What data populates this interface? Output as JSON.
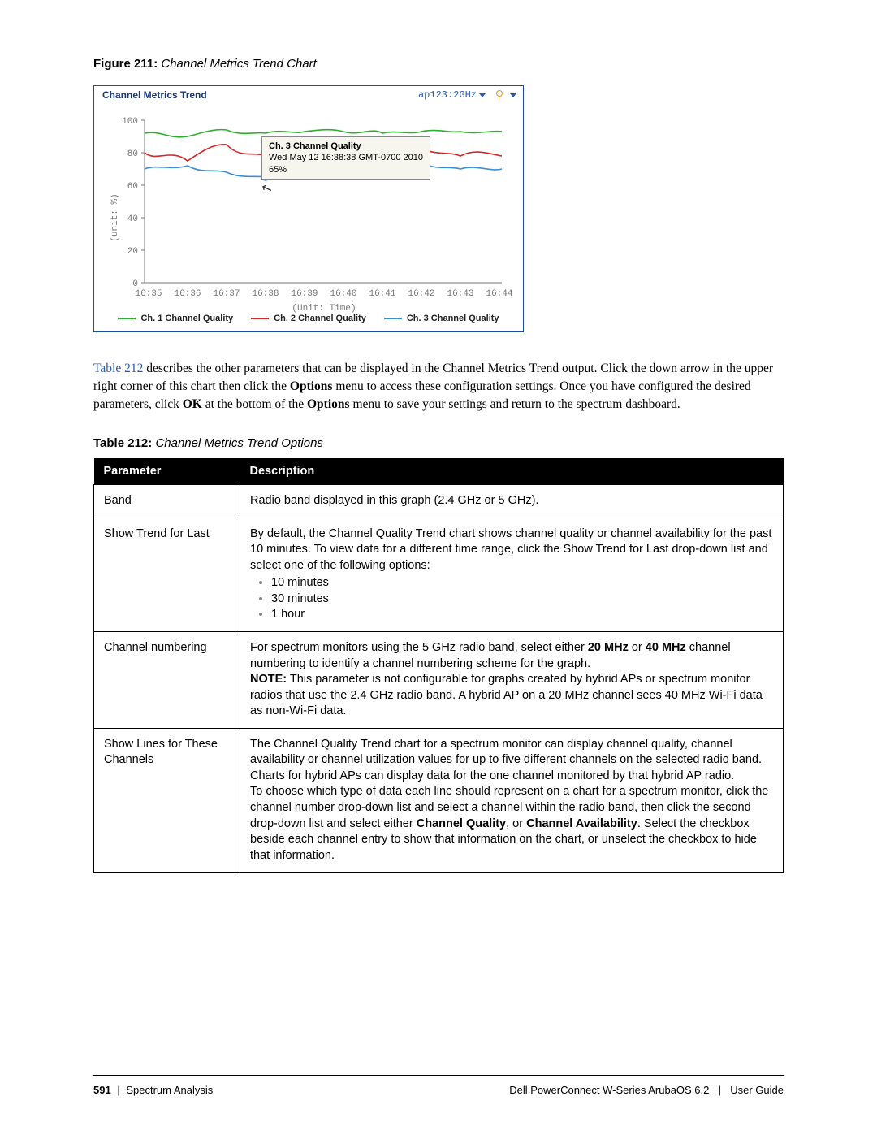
{
  "figure": {
    "label": "Figure 211:",
    "title": "Channel Metrics Trend Chart"
  },
  "chart": {
    "panel_title": "Channel Metrics Trend",
    "band_label": "ap123:2GHz",
    "tooltip_title": "Ch. 3 Channel Quality",
    "tooltip_time": "Wed May 12 16:38:38 GMT-0700 2010",
    "tooltip_val": "65%",
    "ylabel": "(unit: %)",
    "xlabel": "(Unit: Time)",
    "legend": {
      "s1": "Ch. 1 Channel Quality",
      "s2": "Ch. 2 Channel Quality",
      "s3": "Ch. 3 Channel Quality"
    }
  },
  "chart_data": {
    "type": "line",
    "title": "Channel Metrics Trend",
    "xlabel": "(Unit: Time)",
    "ylabel": "(unit: %)",
    "ylim": [
      0,
      100
    ],
    "categories": [
      "16:35",
      "16:36",
      "16:37",
      "16:38",
      "16:39",
      "16:40",
      "16:41",
      "16:42",
      "16:43",
      "16:44"
    ],
    "series": [
      {
        "name": "Ch. 1 Channel Quality",
        "color": "#2fae2f",
        "values": [
          92,
          90,
          94,
          92,
          95,
          93,
          96,
          92,
          95,
          93
        ]
      },
      {
        "name": "Ch. 2 Channel Quality",
        "color": "#d62728",
        "values": [
          80,
          75,
          85,
          78,
          82,
          74,
          80,
          77,
          83,
          78
        ]
      },
      {
        "name": "Ch. 3 Channel Quality",
        "color": "#3b8fd6",
        "values": [
          70,
          72,
          68,
          65,
          70,
          66,
          72,
          69,
          74,
          70
        ]
      }
    ],
    "tooltip_point": {
      "series": "Ch. 3 Channel Quality",
      "x": "16:38",
      "value": 65,
      "timestamp": "Wed May 12 16:38:38 GMT-0700 2010"
    }
  },
  "para": {
    "link": "Table 212",
    "t1": " describes the other parameters that can be displayed in the Channel Metrics Trend output. Click the down arrow in the upper right corner of this chart then click the ",
    "b1": "Options",
    "t2": " menu to access these configuration settings. Once you have configured the desired parameters, click ",
    "b2": "OK",
    "t3": " at the bottom of the ",
    "b3": "Options",
    "t4": " menu to save your settings and return to the spectrum dashboard."
  },
  "table_caption": {
    "label": "Table 212:",
    "title": "Channel Metrics Trend Options"
  },
  "th": {
    "p": "Parameter",
    "d": "Description"
  },
  "rows": {
    "r1p": "Band",
    "r1d": "Radio band displayed in this graph (2.4 GHz or 5 GHz).",
    "r2p": "Show Trend for Last",
    "r2d1": "By default, the Channel Quality Trend chart shows channel quality or channel availability for the past 10 minutes. To view data for a different time range, click the Show Trend for Last drop-down list and select one of the following options:",
    "r2li1": "10 minutes",
    "r2li2": "30 minutes",
    "r2li3": "1 hour",
    "r3p": "Channel numbering",
    "r3d_a": "For spectrum monitors using the 5 GHz radio band, select either ",
    "r3d_b1": "20 MHz",
    "r3d_b": " or ",
    "r3d_b2": "40 MHz",
    "r3d_c": " channel numbering to identify a channel numbering scheme for the graph.",
    "r3d_note_l": "NOTE:",
    "r3d_note": " This parameter is not configurable for graphs created by hybrid APs or spectrum monitor radios that use the 2.4 GHz radio band. A hybrid AP on a 20 MHz channel sees 40 MHz Wi-Fi data as non-Wi-Fi data.",
    "r4p": "Show Lines for These Channels",
    "r4d1": "The Channel Quality Trend chart for a spectrum monitor can display channel quality, channel availability or channel utilization values for up to five different channels on the selected radio band. Charts for hybrid APs can display data for the one channel monitored by that hybrid AP radio.",
    "r4d2a": "To choose which type of data each line should represent on a chart for a spectrum monitor, click the channel number drop-down list and select a channel within the radio band, then click the second drop-down list and select either ",
    "r4d2_b1": "Channel Quality",
    "r4d2_m": ", or ",
    "r4d2_b2": "Channel Availability",
    "r4d2b": ". Select the checkbox beside each channel entry to show that information on the chart, or unselect the checkbox to hide that information."
  },
  "footer": {
    "page": "591",
    "section": "Spectrum Analysis",
    "product": "Dell PowerConnect W-Series ArubaOS 6.2",
    "doc": "User Guide"
  }
}
